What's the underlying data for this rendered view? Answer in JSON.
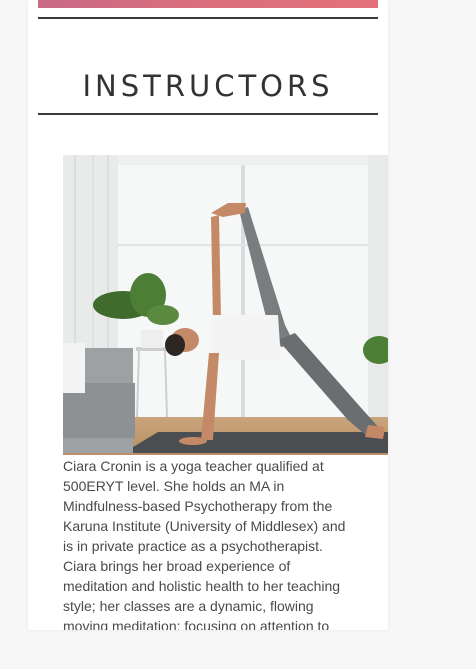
{
  "section": {
    "title": "INSTRUCTORS"
  },
  "instructor": {
    "photo_alt": "yoga-pose-photo",
    "bio": "Ciara Cronin is a yoga teacher qualified at 500ERYT level. She holds an MA in Mindfulness-based Psychotherapy from the Karuna Institute (University of Middlesex) and is in private practice as a psychotherapist. Ciara brings her broad experience of meditation and holistic health to her teaching style; her classes are a dynamic, flowing moving meditation: focusing on attention to"
  },
  "colors": {
    "banner_start": "#c96a86",
    "banner_end": "#e2707a",
    "rule": "#3a3a3a",
    "text": "#4a4a4a"
  }
}
